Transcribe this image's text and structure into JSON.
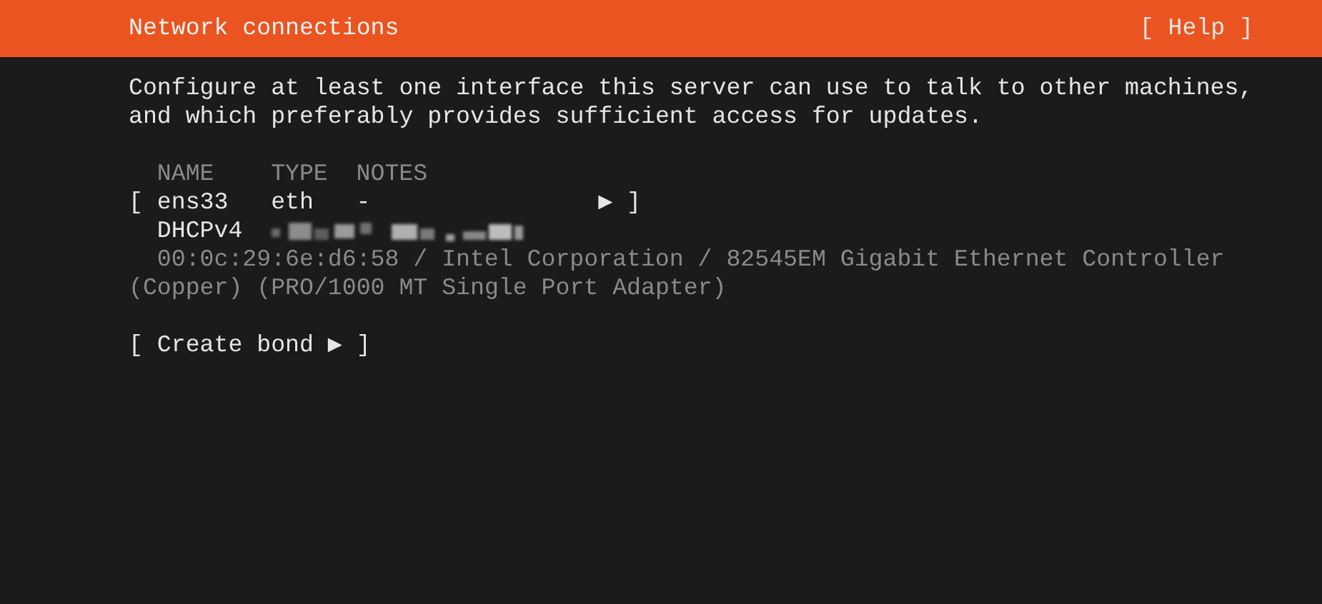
{
  "header": {
    "title": "Network connections",
    "help_button": "[ Help ]"
  },
  "description": "Configure at least one interface this server can use to talk to other machines, and which preferably provides sufficient access for updates.",
  "table": {
    "columns": [
      "NAME",
      "TYPE",
      "NOTES"
    ],
    "interfaces": [
      {
        "open": "[",
        "name": "ens33",
        "type": "eth",
        "notes": "-",
        "arrow": "▶",
        "close": "]",
        "method": "DHCPv4",
        "address_blurred": true,
        "hardware": "00:0c:29:6e:d6:58 / Intel Corporation / 82545EM Gigabit Ethernet Controller (Copper) (PRO/1000 MT Single Port Adapter)"
      }
    ]
  },
  "create_bond_button": "[ Create bond ▶ ]"
}
